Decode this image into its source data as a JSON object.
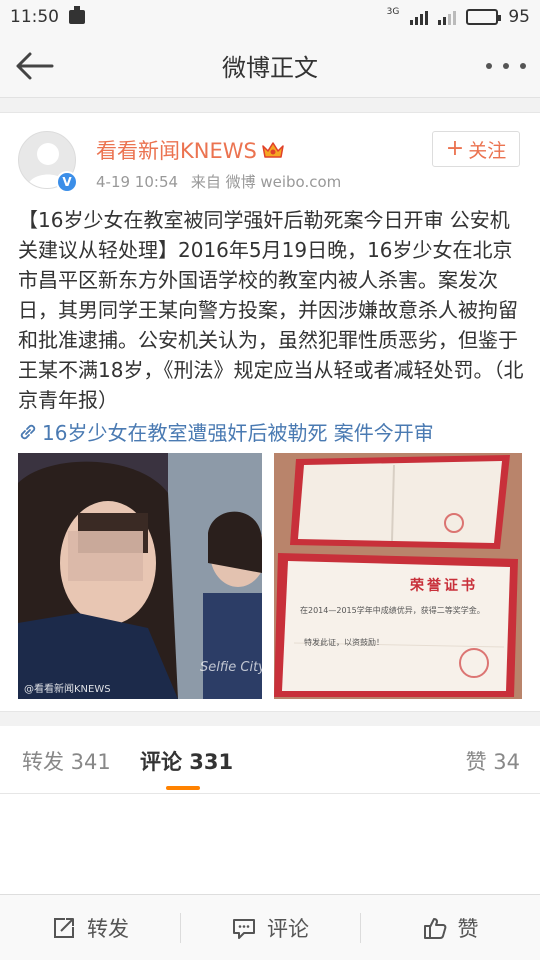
{
  "status_bar": {
    "time": "11:50",
    "network_label": "3G",
    "battery": "95",
    "battery_level": 0.95
  },
  "nav": {
    "title": "微博正文"
  },
  "post": {
    "author": "看看新闻KNEWS",
    "date": "4-19 10:54",
    "source": "来自 微博 weibo.com",
    "follow_label": "关注",
    "text": "【16岁少女在教室被同学强奸后勒死案今日开审 公安机关建议从轻处理】2016年5月19日晚，16岁少女在北京市昌平区新东方外国语学校的教室内被人杀害。案发次日，其男同学王某向警方投案，并因涉嫌故意杀人被拘留和批准逮捕。公安机关认为，虽然犯罪性质恶劣，但鉴于王某不满18岁，《刑法》规定应当从轻或者减轻处罚。（北京青年报）",
    "link_text": "16岁少女在教室遭强奸后被勒死 案件今开审",
    "photo_watermark": "@看看新闻KNEWS",
    "certificate_title": "荣誉证书",
    "certificate_line1": "在2014—2015学年中成绩优异，获得二等奖学金。",
    "certificate_line2": "特发此证，以资鼓励！"
  },
  "tabs": {
    "repost": "转发 341",
    "comment": "评论 331",
    "like": "赞 34"
  },
  "toolbar": {
    "repost": "转发",
    "comment": "评论",
    "like": "赞"
  },
  "colors": {
    "accent": "#eb7350",
    "link": "#4a7ab2",
    "tab_indicator": "#ff8200",
    "verified": "#3b8ee8"
  }
}
